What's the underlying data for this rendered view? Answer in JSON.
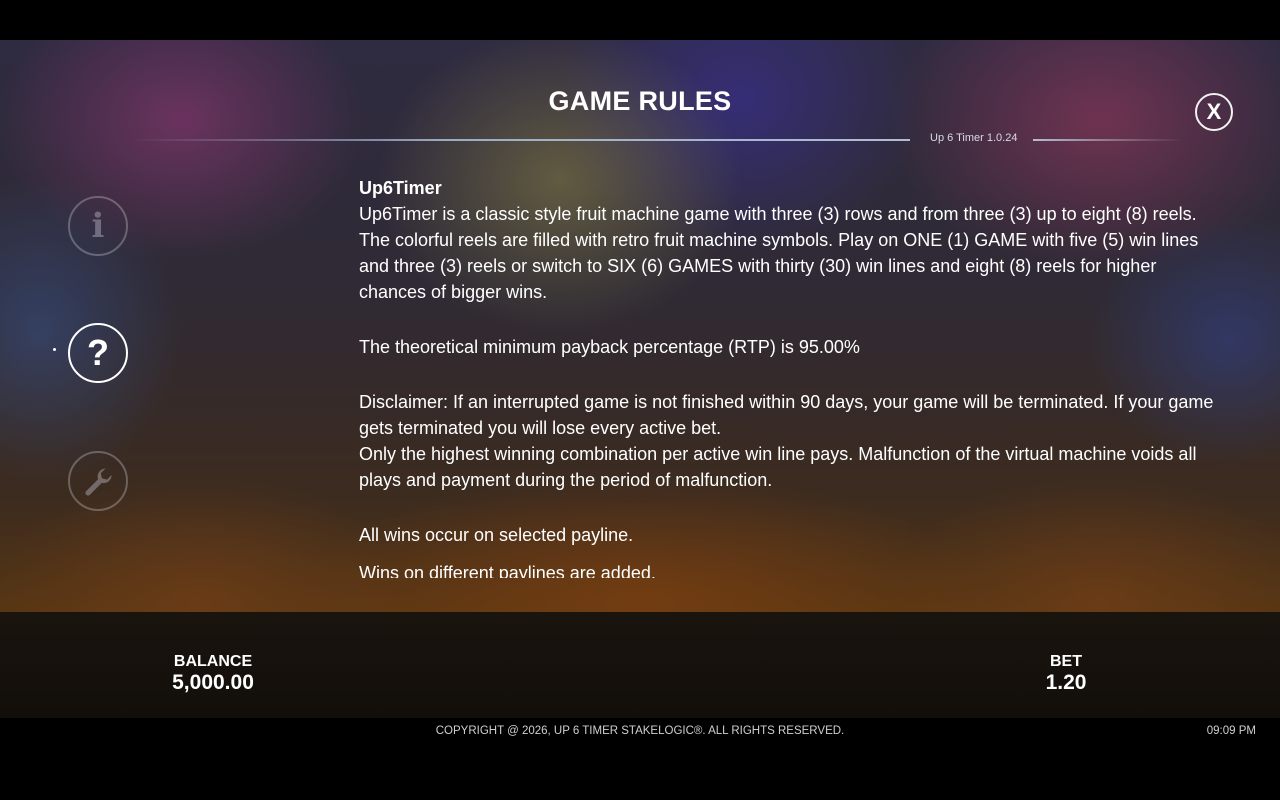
{
  "header": {
    "title": "GAME RULES",
    "version": "Up 6 Timer 1.0.24",
    "close_label": "X"
  },
  "side_nav": [
    {
      "id": "info",
      "icon": "info-icon",
      "glyph": "i",
      "active": false
    },
    {
      "id": "help",
      "icon": "question-icon",
      "glyph": "?",
      "active": true
    },
    {
      "id": "settings",
      "icon": "wrench-icon",
      "active": false
    }
  ],
  "rules": {
    "heading": "Up6Timer",
    "intro": "Up6Timer is a classic style fruit machine game with three (3) rows and from three (3) up to eight (8) reels. The colorful reels are filled with retro fruit machine symbols. Play on ONE (1) GAME with five (5) win lines and three (3) reels or switch to SIX (6) GAMES with thirty (30) win lines and eight (8) reels for higher chances of bigger wins.",
    "rtp": "The theoretical minimum payback percentage (RTP) is 95.00%",
    "disclaimer": "Disclaimer: If an interrupted game is not finished within 90 days, your game will be terminated. If your game gets terminated you will lose every active bet.",
    "malfunction": "Only the highest winning combination per active win line pays. Malfunction of the virtual machine voids all plays and payment during the period of malfunction.",
    "payline": "All wins occur on selected payline.",
    "added": "Wins on different paylines are added."
  },
  "footer": {
    "balance_label": "BALANCE",
    "balance_value": "5,000.00",
    "bet_label": "BET",
    "bet_value": "1.20",
    "copyright": "COPYRIGHT @ 2026, UP 6 TIMER STAKELOGIC®. ALL RIGHTS RESERVED.",
    "time": "09:09 PM"
  }
}
